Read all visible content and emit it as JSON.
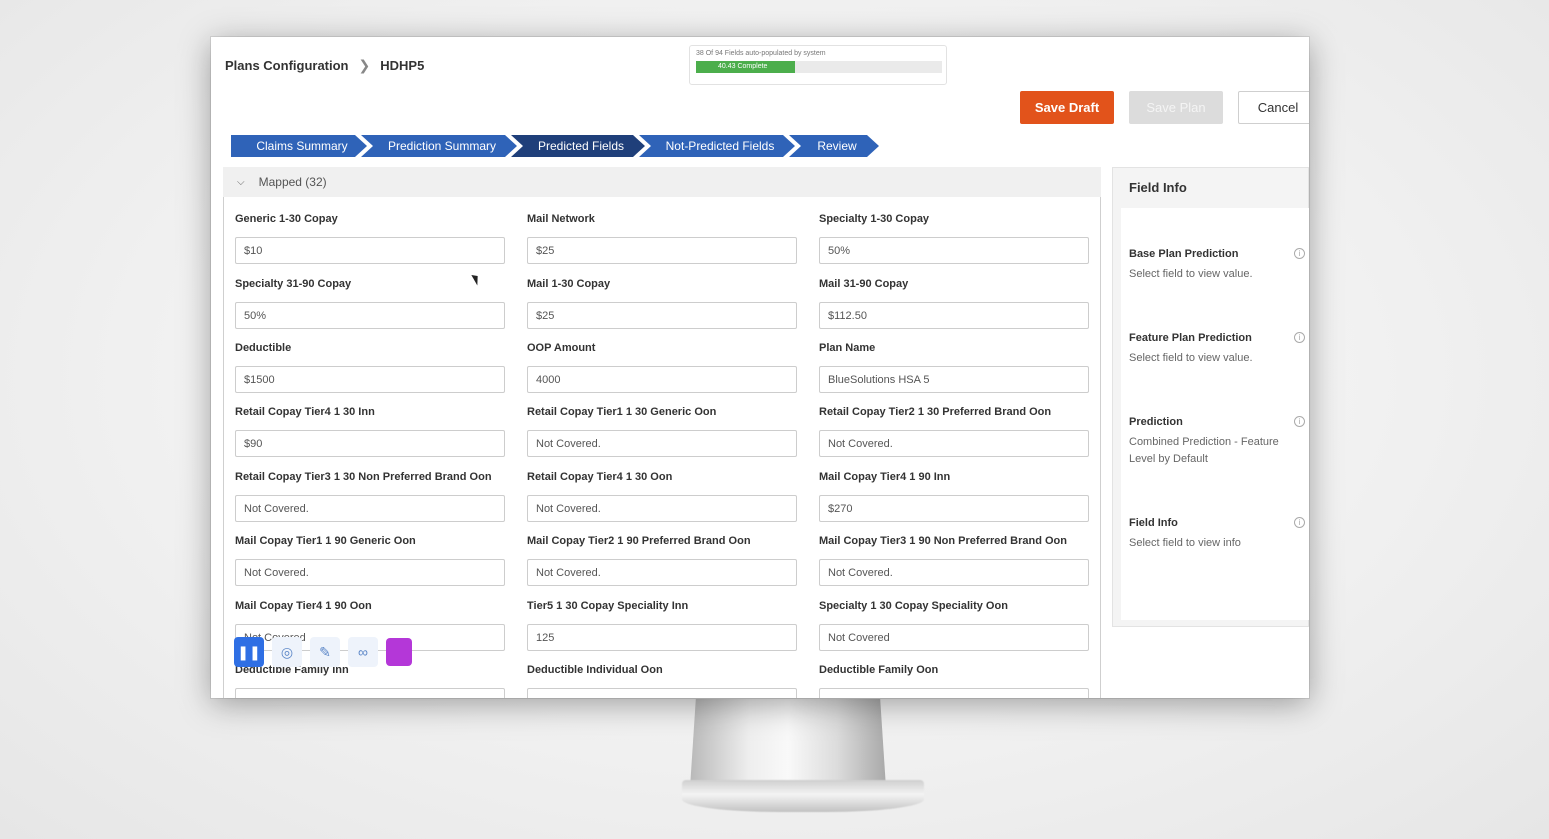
{
  "breadcrumb": {
    "parent": "Plans Configuration",
    "current": "HDHP5"
  },
  "progress": {
    "text": "38 Of 94 Fields auto-populated by system",
    "fill_label": "40.43 Complete",
    "percent": 40.43,
    "color": "#4cae4c"
  },
  "actions": {
    "save_draft": "Save Draft",
    "save_plan": "Save Plan",
    "cancel": "Cancel",
    "accent": "#e2531b"
  },
  "steps": [
    "Claims Summary",
    "Prediction Summary",
    "Predicted Fields",
    "Not-Predicted Fields",
    "Review"
  ],
  "mapped": {
    "title": "Mapped (32)"
  },
  "fields": [
    {
      "label": "Generic 1-30 Copay",
      "value": "$10"
    },
    {
      "label": "Mail Network",
      "value": "$25"
    },
    {
      "label": "Specialty 1-30 Copay",
      "value": "50%"
    },
    {
      "label": "Specialty 31-90 Copay",
      "value": "50%"
    },
    {
      "label": "Mail 1-30 Copay",
      "value": "$25"
    },
    {
      "label": "Mail 31-90 Copay",
      "value": "$112.50"
    },
    {
      "label": "Deductible",
      "value": "$1500"
    },
    {
      "label": "OOP Amount",
      "value": "4000"
    },
    {
      "label": "Plan Name",
      "value": "BlueSolutions HSA 5"
    },
    {
      "label": "Retail Copay Tier4 1 30 Inn",
      "value": "$90"
    },
    {
      "label": "Retail Copay Tier1 1 30 Generic Oon",
      "value": "Not Covered."
    },
    {
      "label": "Retail Copay Tier2 1 30 Preferred Brand Oon",
      "value": "Not Covered."
    },
    {
      "label": "Retail Copay Tier3 1 30 Non Preferred Brand Oon",
      "value": "Not Covered."
    },
    {
      "label": "Retail Copay Tier4 1 30 Oon",
      "value": "Not Covered."
    },
    {
      "label": "Mail Copay Tier4 1 90 Inn",
      "value": "$270"
    },
    {
      "label": "Mail Copay Tier1 1 90 Generic Oon",
      "value": "Not Covered."
    },
    {
      "label": "Mail Copay Tier2 1 90 Preferred Brand Oon",
      "value": "Not Covered."
    },
    {
      "label": "Mail Copay Tier3 1 90 Non Preferred Brand Oon",
      "value": "Not Covered."
    },
    {
      "label": "Mail Copay Tier4 1 90 Oon",
      "value": "Not Covered"
    },
    {
      "label": "Tier5 1 30 Copay Speciality Inn",
      "value": "125"
    },
    {
      "label": "Specialty 1 30 Copay Speciality Oon",
      "value": "Not Covered"
    },
    {
      "label": "Deductible Family Inn",
      "value": ""
    },
    {
      "label": "Deductible Individual Oon",
      "value": ""
    },
    {
      "label": "Deductible Family Oon",
      "value": ""
    }
  ],
  "side_panel": {
    "title": "Field Info",
    "items": [
      {
        "title": "Base Plan Prediction",
        "desc": "Select field to view value."
      },
      {
        "title": "Feature Plan Prediction",
        "desc": "Select field to view value."
      },
      {
        "title": "Prediction",
        "desc": "Combined Prediction - Feature Level by Default"
      },
      {
        "title": "Field Info",
        "desc": "Select field to view info"
      }
    ]
  },
  "toolbar": {
    "pause_icon": "pause-icon",
    "tools": [
      "globe-icon",
      "pencil-icon",
      "link-icon"
    ],
    "swatch_color": "#b437d8"
  }
}
